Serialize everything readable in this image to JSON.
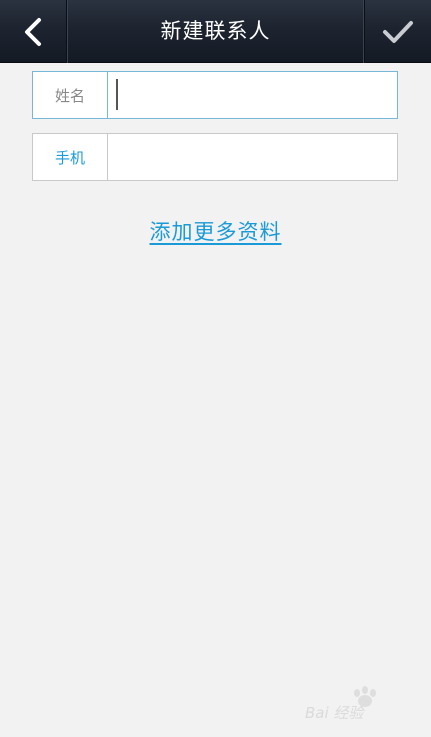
{
  "header": {
    "title": "新建联系人",
    "back_icon": "chevron-left-icon",
    "done_icon": "checkmark-icon"
  },
  "form": {
    "name": {
      "label": "姓名",
      "value": "",
      "placeholder": ""
    },
    "phone": {
      "label": "手机",
      "value": "",
      "placeholder": ""
    }
  },
  "actions": {
    "add_more_label": "添加更多资料"
  },
  "colors": {
    "header_bg": "#1d2430",
    "page_bg": "#f2f2f2",
    "accent": "#1a9ad6",
    "name_label": "#888888",
    "focus_border": "#77b8d8"
  },
  "watermark": {
    "icon": "baidu-paw-logo-icon",
    "text": "Bai 经验"
  }
}
